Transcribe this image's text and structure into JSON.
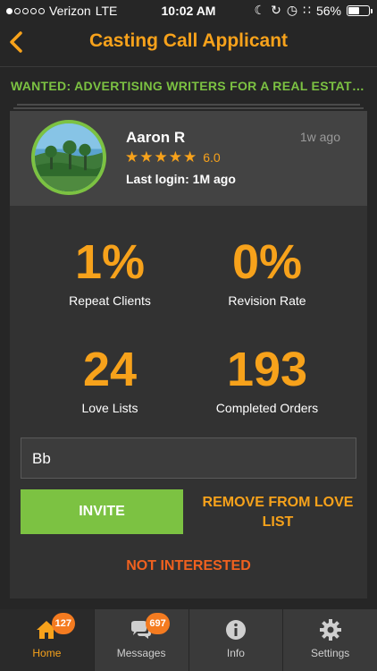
{
  "status_bar": {
    "carrier": "Verizon",
    "network": "LTE",
    "time": "10:02 AM",
    "battery": "56%",
    "battery_level": 0.56
  },
  "nav": {
    "title": "Casting Call Applicant",
    "back_icon": "chevron-left-icon"
  },
  "job": {
    "title": "WANTED: ADVERTISING WRITERS FOR A REAL ESTATE COMPANY"
  },
  "applicant": {
    "name": "Aaron R",
    "time_ago": "1w ago",
    "stars": "★★★★★",
    "rating": "6.0",
    "last_login": "Last login: 1M ago"
  },
  "stats": [
    {
      "value": "1%",
      "label": "Repeat Clients"
    },
    {
      "value": "0%",
      "label": "Revision Rate"
    },
    {
      "value": "24",
      "label": "Love Lists"
    },
    {
      "value": "193",
      "label": "Completed Orders"
    }
  ],
  "note": {
    "value": "Bb"
  },
  "actions": {
    "invite": "INVITE",
    "remove": "REMOVE FROM LOVE LIST",
    "not_interested": "NOT INTERESTED"
  },
  "tabs": [
    {
      "label": "Home",
      "icon": "home-icon",
      "badge": "127",
      "active": true
    },
    {
      "label": "Messages",
      "icon": "chat-bubbles-icon",
      "badge": "697",
      "active": false
    },
    {
      "label": "Info",
      "icon": "info-icon",
      "badge": "",
      "active": false
    },
    {
      "label": "Settings",
      "icon": "gear-icon",
      "badge": "",
      "active": false
    }
  ],
  "colors": {
    "accent": "#f7a21b",
    "green": "#7cc242",
    "danger": "#f0611f",
    "badge": "#f47b20"
  }
}
